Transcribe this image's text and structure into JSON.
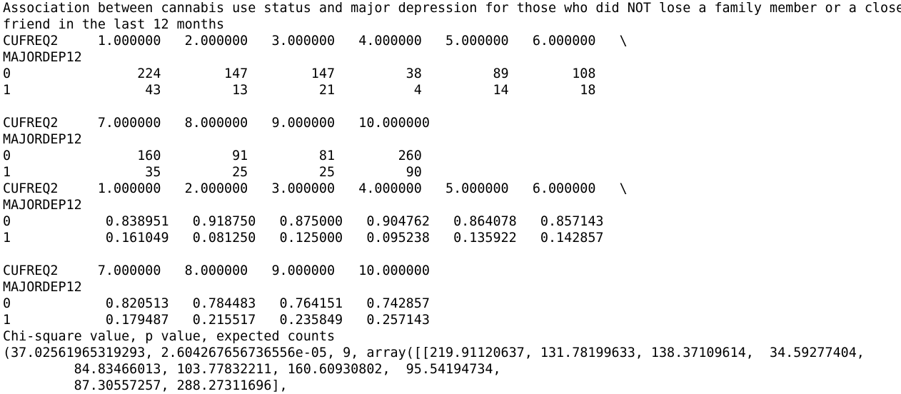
{
  "output": {
    "lines": [
      "Association between cannabis use status and major depression for those who did NOT lose a family member or a close",
      "friend in the last 12 months",
      "CUFREQ2     1.000000   2.000000   3.000000   4.000000   5.000000   6.000000   \\",
      "MAJORDEP12",
      "0                224        147        147         38         89        108",
      "1                 43         13         21          4         14         18",
      "",
      "CUFREQ2     7.000000   8.000000   9.000000   10.000000",
      "MAJORDEP12",
      "0                160         91         81        260",
      "1                 35         25         25         90",
      "CUFREQ2     1.000000   2.000000   3.000000   4.000000   5.000000   6.000000   \\",
      "MAJORDEP12",
      "0            0.838951   0.918750   0.875000   0.904762   0.864078   0.857143",
      "1            0.161049   0.081250   0.125000   0.095238   0.135922   0.142857",
      "",
      "CUFREQ2     7.000000   8.000000   9.000000   10.000000",
      "MAJORDEP12",
      "0            0.820513   0.784483   0.764151   0.742857",
      "1            0.179487   0.215517   0.235849   0.257143",
      "Chi-square value, p value, expected counts",
      "(37.02561965319293, 2.604267656736556e-05, 9, array([[219.91120637, 131.78199633, 138.37109614,  34.59277404,",
      "         84.83466013, 103.77832211, 160.60930802,  95.54194734,",
      "         87.30557257, 288.27311696],"
    ]
  }
}
